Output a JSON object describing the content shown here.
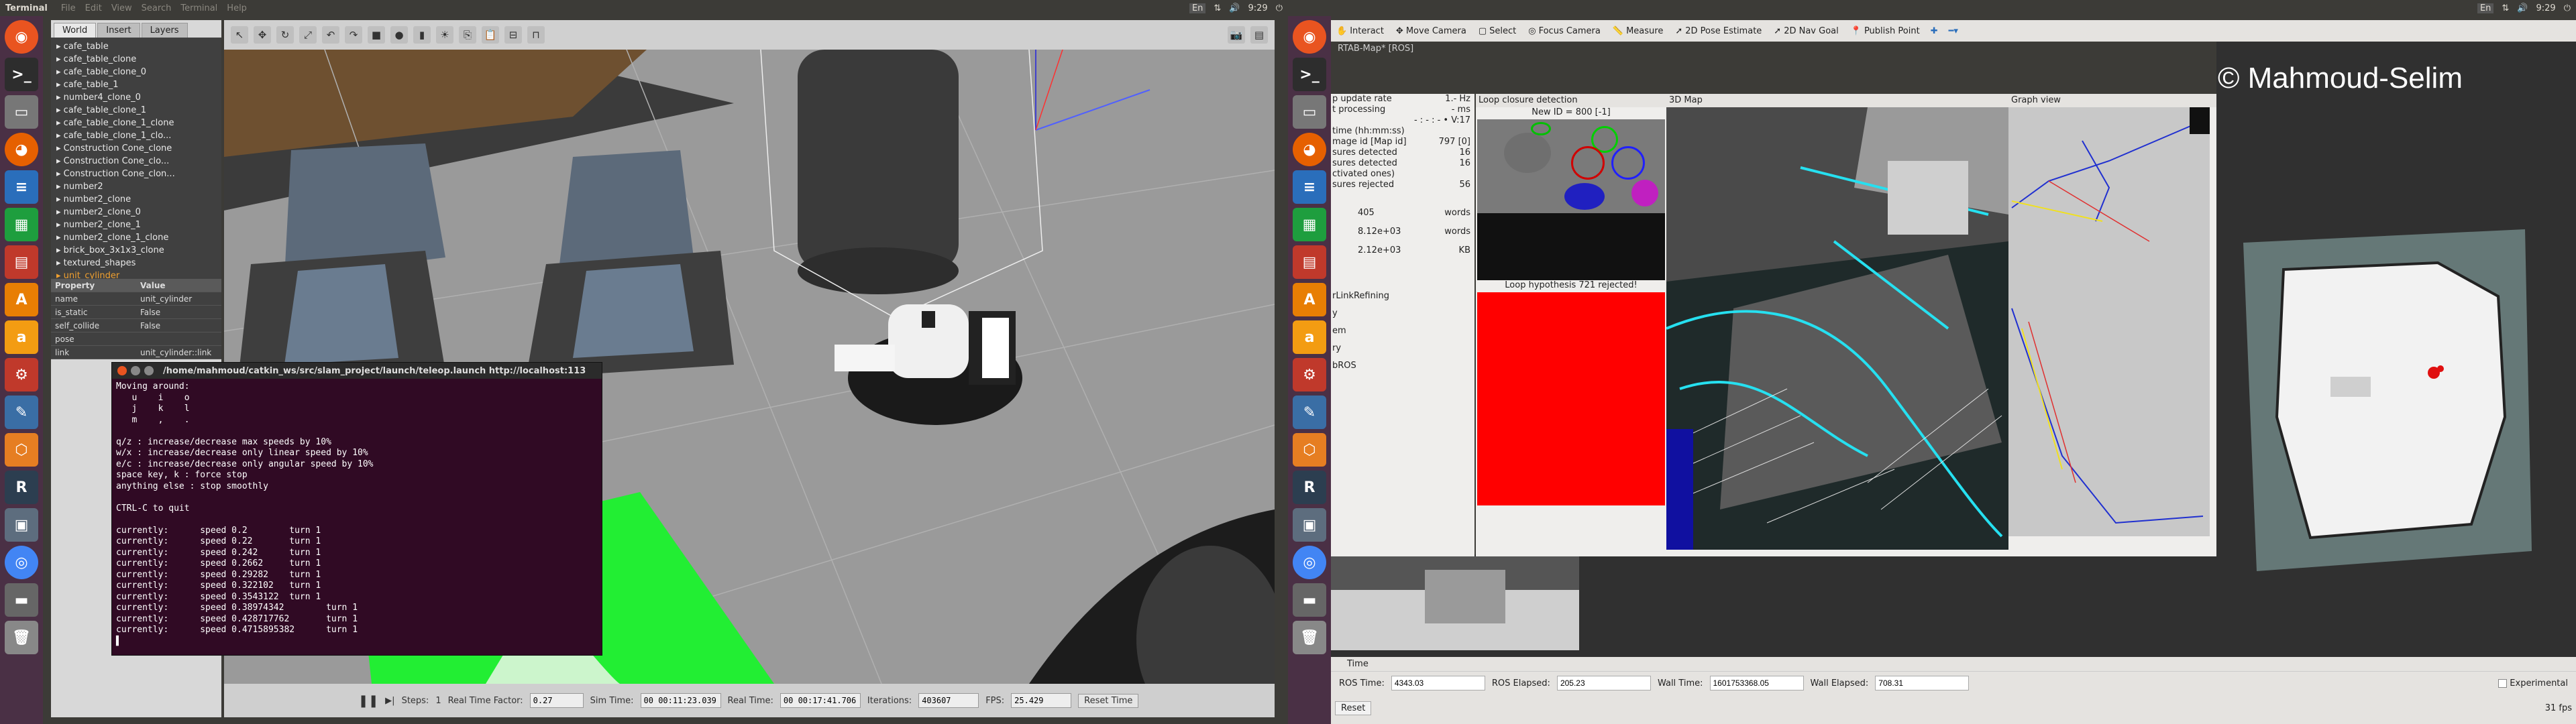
{
  "topbar_left": {
    "title": "Terminal",
    "menus": [
      "File",
      "Edit",
      "View",
      "Search",
      "Terminal",
      "Help"
    ],
    "time": "9:29",
    "lang": "En"
  },
  "topbar_right": {
    "time": "9:29",
    "lang": "En"
  },
  "gazebo": {
    "tabs": [
      "World",
      "Insert",
      "Layers"
    ],
    "tree": [
      "cafe_table",
      "cafe_table_clone",
      "cafe_table_clone_0",
      "cafe_table_1",
      "number4_clone_0",
      "cafe_table_clone_1",
      "cafe_table_clone_1_clone",
      "cafe_table_clone_1_clo...",
      "Construction Cone_clone",
      "Construction Cone_clo...",
      "Construction Cone_clon...",
      "number2",
      "number2_clone",
      "number2_clone_0",
      "number2_clone_1",
      "number2_clone_1_clone",
      "brick_box_3x1x3_clone",
      "textured_shapes",
      "unit_cylinder"
    ],
    "props_header": [
      "Property",
      "Value"
    ],
    "props": [
      {
        "k": "name",
        "v": "unit_cylinder"
      },
      {
        "k": "is_static",
        "v": "False"
      },
      {
        "k": "self_collide",
        "v": "False"
      },
      {
        "k": "pose",
        "v": ""
      },
      {
        "k": "link",
        "v": "unit_cylinder::link"
      }
    ],
    "bottom": {
      "steps_label": "Steps:",
      "steps_val": "1",
      "rtf_label": "Real Time Factor:",
      "rtf": "0.27",
      "sim_label": "Sim Time:",
      "sim": "00 00:11:23.039",
      "real_label": "Real Time:",
      "real": "00 00:17:41.706",
      "iter_label": "Iterations:",
      "iter": "403607",
      "fps_label": "FPS:",
      "fps": "25.429",
      "reset": "Reset Time"
    }
  },
  "terminal": {
    "title": "/home/mahmoud/catkin_ws/src/slam_project/launch/teleop.launch http://localhost:113",
    "lines": [
      "Moving around:",
      "   u    i    o",
      "   j    k    l",
      "   m    ,    .",
      "",
      "q/z : increase/decrease max speeds by 10%",
      "w/x : increase/decrease only linear speed by 10%",
      "e/c : increase/decrease only angular speed by 10%",
      "space key, k : force stop",
      "anything else : stop smoothly",
      "",
      "CTRL-C to quit",
      "",
      "currently:      speed 0.2        turn 1",
      "currently:      speed 0.22       turn 1",
      "currently:      speed 0.242      turn 1",
      "currently:      speed 0.2662     turn 1",
      "currently:      speed 0.29282    turn 1",
      "currently:      speed 0.322102   turn 1",
      "currently:      speed 0.3543122  turn 1",
      "currently:      speed 0.38974342        turn 1",
      "currently:      speed 0.428717762       turn 1",
      "currently:      speed 0.4715895382      turn 1",
      "▌"
    ]
  },
  "rviz": {
    "tools": [
      "Interact",
      "Move Camera",
      "Select",
      "Focus Camera",
      "Measure",
      "2D Pose Estimate",
      "2D Nav Goal",
      "Publish Point"
    ],
    "rtab_title": "RTAB-Map* [ROS]",
    "left_rows": [
      {
        "k": "p update rate",
        "v": "1.- Hz"
      },
      {
        "k": "t processing",
        "v": "- ms"
      },
      {
        "k": "",
        "v": "- : - : - • V:17"
      },
      {
        "k": "time (hh:mm:ss)",
        "v": ""
      },
      {
        "k": "mage id [Map id]",
        "v": "797 [0]"
      },
      {
        "k": "sures detected",
        "v": "16"
      },
      {
        "k": "sures detected",
        "v": "16"
      },
      {
        "k": "ctivated ones)",
        "v": ""
      },
      {
        "k": "sures rejected",
        "v": "56"
      }
    ],
    "left_words": [
      {
        "v": "405",
        "u": "words"
      },
      {
        "v": "8.12e+03",
        "u": "words"
      },
      {
        "v": "2.12e+03",
        "u": "KB"
      }
    ],
    "left_labels": [
      "rLinkRefining",
      "y",
      "em",
      "ry",
      "bROS"
    ],
    "loop_title": "Loop closure detection",
    "loop_new_id": "New ID = 800 [-1]",
    "loop_rejected": "Loop hypothesis 721 rejected!",
    "map3d_title": "3D Map",
    "graph_title": "Graph view",
    "watermark": "© Mahmoud-Selim",
    "time_panel": "Time",
    "ros_time_label": "ROS Time:",
    "ros_time": "4343.03",
    "ros_elapsed_label": "ROS Elapsed:",
    "ros_elapsed": "205.23",
    "wall_time_label": "Wall Time:",
    "wall_time": "1601753368.05",
    "wall_elapsed_label": "Wall Elapsed:",
    "wall_elapsed": "708.31",
    "experimental": "Experimental",
    "reset": "Reset",
    "fps": "31 fps"
  },
  "colors": {
    "launcher": "#4a3045",
    "terminal_bg": "#300a24",
    "loop_red": "#ff0000",
    "ground": "#9a9a9a"
  }
}
